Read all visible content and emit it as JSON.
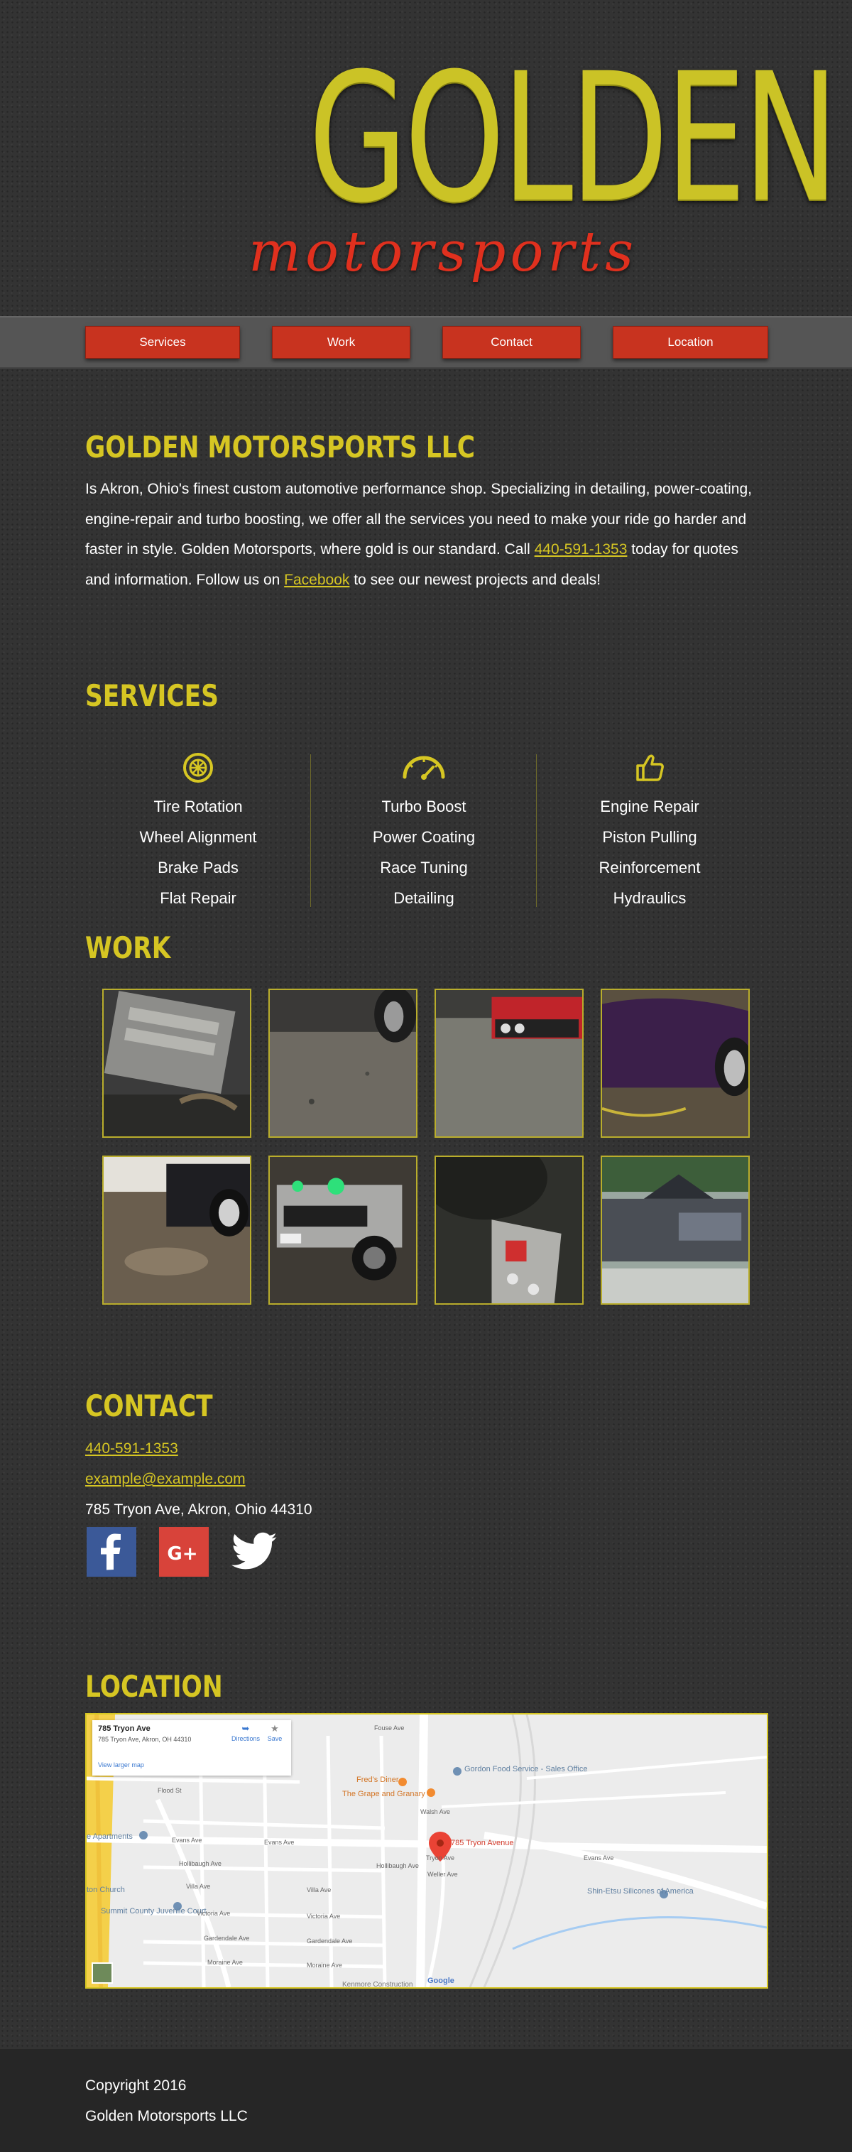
{
  "logo": {
    "main": "GOLDEN",
    "sub": "motorsports"
  },
  "nav": [
    {
      "label": "Services"
    },
    {
      "label": "Work"
    },
    {
      "label": "Contact"
    },
    {
      "label": "Location"
    }
  ],
  "about": {
    "title": "GOLDEN MOTORSPORTS LLC",
    "text_before_phone": "Is Akron, Ohio's finest custom automotive performance shop. Specializing in detailing, power-coating, engine-repair and turbo boosting, we offer all the services you need to make your ride go harder and faster in style. Golden Motorsports, where gold is our standard. Call ",
    "phone": "440-591-1353",
    "text_after_phone": " today for quotes and information. Follow us on ",
    "facebook_link": "Facebook",
    "text_end": " to see our newest projects and deals!"
  },
  "services": {
    "title": "SERVICES",
    "columns": [
      {
        "icon": "wheel-icon",
        "items": [
          "Tire Rotation",
          "Wheel Alignment",
          "Brake Pads",
          "Flat Repair"
        ]
      },
      {
        "icon": "speedometer-icon",
        "items": [
          "Turbo Boost",
          "Power Coating",
          "Race Tuning",
          "Detailing"
        ]
      },
      {
        "icon": "thumbs-up-icon",
        "items": [
          "Engine Repair",
          "Piston Pulling",
          "Reinforcement",
          "Hydraulics"
        ]
      }
    ],
    "accent_color": "#d6c623"
  },
  "work": {
    "title": "WORK"
  },
  "contact": {
    "title": "CONTACT",
    "phone": "440-591-1353",
    "email": "example@example.com",
    "address": "785 Tryon Ave, Akron, Ohio 44310",
    "social": [
      "facebook-icon",
      "google-plus-icon",
      "twitter-icon"
    ]
  },
  "location": {
    "title": "LOCATION",
    "card": {
      "title": "785 Tryon Ave",
      "address": "785 Tryon Ave, Akron, OH 44310",
      "directions": "Directions",
      "save": "Save",
      "larger_map": "View larger map"
    },
    "map_labels": {
      "pin": "785 Tryon Avenue",
      "freds": "Fred's Diner",
      "grape": "The Grape and Granary",
      "gordon": "Gordon Food Service - Sales Office",
      "shin": "Shin-Etsu Silicones of America",
      "summit": "Summit County Juvenile Court",
      "church": "ton Church",
      "apartments": "e Apartments",
      "evans1": "Evans Ave",
      "evans2": "Evans Ave",
      "evans3": "Evans Ave",
      "fouse": "Fouse Ave",
      "walsh": "Walsh Ave",
      "tryon": "Tryon Ave",
      "weller": "Weller Ave",
      "hollibaugh": "Hollibaugh Ave",
      "hollibaugh2": "Hollibaugh Ave",
      "villa": "Villa Ave",
      "villa2": "Villa Ave",
      "victoria": "Victoria Ave",
      "victoria2": "Victoria Ave",
      "gardendale": "Gardendale Ave",
      "gardendale2": "Gardendale Ave",
      "moraine": "Moraine Ave",
      "moraine2": "Moraine Ave",
      "flood": "Flood St",
      "kenmore": "Kenmore Construction",
      "google": "Google"
    }
  },
  "footer": {
    "copyright": "Copyright 2016",
    "company": "Golden Motorsports LLC"
  }
}
